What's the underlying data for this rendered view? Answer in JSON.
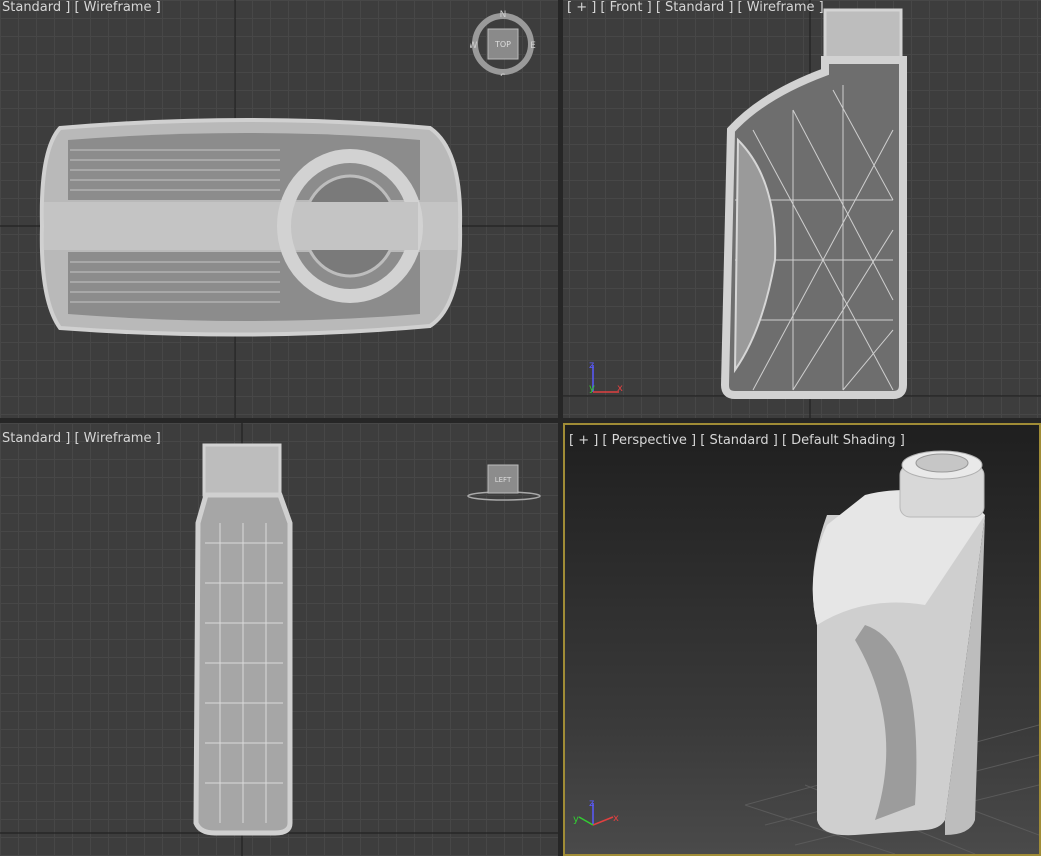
{
  "viewports": {
    "top": {
      "label": "Standard ] [ Wireframe ]",
      "cube_label": "TOP",
      "compass": {
        "n": "N",
        "s": "S",
        "e": "E",
        "w": "W"
      }
    },
    "front": {
      "label": "[ + ] [ Front ] [ Standard ] [ Wireframe ]"
    },
    "left": {
      "label": "Standard ] [ Wireframe ]",
      "cube_label": "LEFT"
    },
    "perspective": {
      "label": "[ + ] [ Perspective ] [ Standard ] [ Default Shading ]"
    }
  },
  "colors": {
    "active_border": "#a08c36",
    "grid_bg": "#3d3d3d",
    "wire": "#c8c8c8"
  },
  "axis_labels": {
    "x": "x",
    "y": "y",
    "z": "z"
  }
}
